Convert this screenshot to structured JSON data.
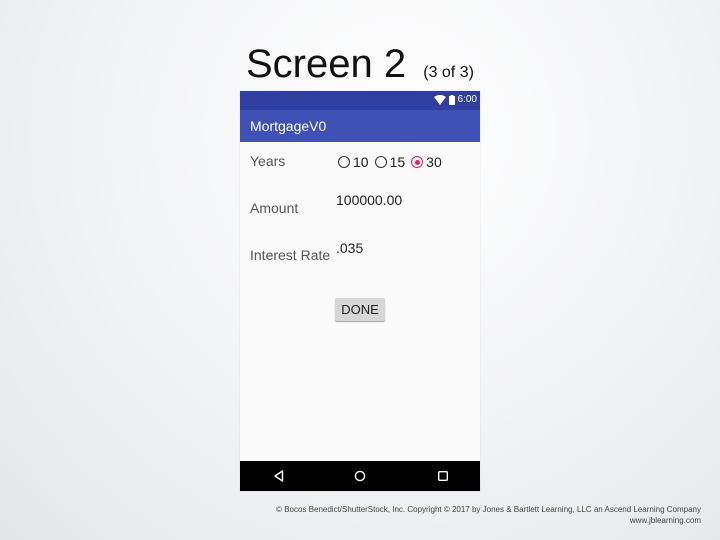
{
  "slide": {
    "title": "Screen 2",
    "subtitle": "(3 of 3)"
  },
  "status_bar": {
    "time": "6:00",
    "icons": [
      "wifi-icon",
      "battery-icon"
    ],
    "color": "#303f9f"
  },
  "app_bar": {
    "title": "MortgageV0",
    "color": "#3f51b5"
  },
  "form": {
    "years": {
      "label": "Years",
      "options": [
        {
          "label": "10",
          "checked": false
        },
        {
          "label": "15",
          "checked": false
        },
        {
          "label": "30",
          "checked": true
        }
      ],
      "accent": "#e91e63"
    },
    "amount": {
      "label": "Amount",
      "value": "100000.00"
    },
    "interest_rate": {
      "label": "Interest Rate",
      "value": ".035"
    },
    "done_label": "DONE"
  },
  "nav_bar": {
    "icons": [
      "back-icon",
      "home-icon",
      "recents-icon"
    ]
  },
  "footer": {
    "copyright": "© Bocos Benedict/ShutterStock, Inc. Copyright © 2017 by Jones & Bartlett Learning, LLC an Ascend Learning Company",
    "url": "www.jblearning.com"
  }
}
